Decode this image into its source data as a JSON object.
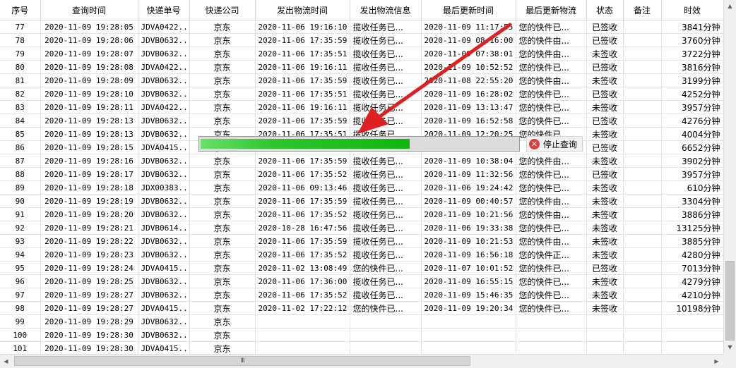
{
  "columns": [
    "序号",
    "查询时间",
    "快递单号",
    "快递公司",
    "发出物流时间",
    "发出物流信息",
    "最后更新时间",
    "最后更新物流",
    "状态",
    "备注",
    "时效"
  ],
  "rows": [
    [
      "77",
      "2020-11-09 19:28:05",
      "JDVA0422...",
      "京东",
      "2020-11-06 19:16:10",
      "揽收任务已...",
      "2020-11-09 11:17:55",
      "您的快件已...",
      "已签收",
      "",
      "3841分钟"
    ],
    [
      "78",
      "2020-11-09 19:28:06",
      "JDVB0632...",
      "京东",
      "2020-11-06 17:35:59",
      "揽收任务已...",
      "2020-11-09 08:16:00",
      "您的快件由...",
      "已签收",
      "",
      "3760分钟"
    ],
    [
      "79",
      "2020-11-09 19:28:07",
      "JDVB0632...",
      "京东",
      "2020-11-06 17:35:51",
      "揽收任务已...",
      "2020-11-09 07:38:01",
      "您的快件由...",
      "未签收",
      "",
      "3722分钟"
    ],
    [
      "80",
      "2020-11-09 19:28:08",
      "JDVA0422...",
      "京东",
      "2020-11-06 19:16:11",
      "揽收任务已...",
      "2020-11-09 10:52:52",
      "您的快件已...",
      "已签收",
      "",
      "3816分钟"
    ],
    [
      "81",
      "2020-11-09 19:28:09",
      "JDVB0632...",
      "京东",
      "2020-11-06 17:35:59",
      "揽收任务已...",
      "2020-11-08 22:55:20",
      "您的快件由...",
      "未签收",
      "",
      "3199分钟"
    ],
    [
      "82",
      "2020-11-09 19:28:10",
      "JDVB0632...",
      "京东",
      "2020-11-06 17:35:51",
      "揽收任务已...",
      "2020-11-09 16:28:02",
      "您的快件已...",
      "已签收",
      "",
      "4252分钟"
    ],
    [
      "83",
      "2020-11-09 19:28:11",
      "JDVA0422...",
      "京东",
      "2020-11-06 19:16:11",
      "揽收任务已...",
      "2020-11-09 13:13:47",
      "您的快件已...",
      "未签收",
      "",
      "3957分钟"
    ],
    [
      "84",
      "2020-11-09 19:28:13",
      "JDVB0632...",
      "京东",
      "2020-11-06 17:35:59",
      "揽收任务已...",
      "2020-11-09 16:52:58",
      "您的快件已...",
      "已签收",
      "",
      "4276分钟"
    ],
    [
      "85",
      "2020-11-09 19:28:13",
      "JDVB0632...",
      "京东",
      "2020-11-06 17:35:51",
      "揽收任务已...",
      "2020-11-09 12:20:25",
      "您的快件已...",
      "未签收",
      "",
      "4004分钟"
    ],
    [
      "86",
      "2020-11-09 19:28:15",
      "JDVA0415...",
      "京东",
      "",
      "",
      "",
      "",
      "已签收",
      "",
      "6652分钟"
    ],
    [
      "87",
      "2020-11-09 19:28:16",
      "JDVB0632...",
      "京东",
      "2020-11-06 17:35:59",
      "揽收任务已...",
      "2020-11-09 10:38:04",
      "您的快件由...",
      "未签收",
      "",
      "3902分钟"
    ],
    [
      "88",
      "2020-11-09 19:28:17",
      "JDVB0632...",
      "京东",
      "2020-11-06 17:35:52",
      "揽收任务已...",
      "2020-11-09 11:32:56",
      "您的快件已...",
      "已签收",
      "",
      "3957分钟"
    ],
    [
      "89",
      "2020-11-09 19:28:18",
      "JDX00383...",
      "京东",
      "2020-11-06 09:13:46",
      "揽收任务已...",
      "2020-11-06 19:24:42",
      "您的快件已...",
      "未签收",
      "",
      "610分钟"
    ],
    [
      "90",
      "2020-11-09 19:28:19",
      "JDVB0632...",
      "京东",
      "2020-11-06 17:35:59",
      "揽收任务已...",
      "2020-11-09 00:40:57",
      "您的快件由...",
      "未签收",
      "",
      "3304分钟"
    ],
    [
      "91",
      "2020-11-09 19:28:20",
      "JDVB0632...",
      "京东",
      "2020-11-06 17:35:52",
      "揽收任务已...",
      "2020-11-09 10:21:56",
      "您的快件由...",
      "未签收",
      "",
      "3886分钟"
    ],
    [
      "92",
      "2020-11-09 19:28:21",
      "JDVB0614...",
      "京东",
      "2020-10-28 16:47:56",
      "揽收任务已...",
      "2020-11-06 19:33:38",
      "您的快件已...",
      "未签收",
      "",
      "13125分钟"
    ],
    [
      "93",
      "2020-11-09 19:28:22",
      "JDVB0632...",
      "京东",
      "2020-11-06 17:35:59",
      "揽收任务已...",
      "2020-11-09 10:21:53",
      "您的快件由...",
      "未签收",
      "",
      "3885分钟"
    ],
    [
      "94",
      "2020-11-09 19:28:23",
      "JDVB0632...",
      "京东",
      "2020-11-06 17:35:52",
      "揽收任务已...",
      "2020-11-09 16:56:18",
      "您的快件正...",
      "未签收",
      "",
      "4280分钟"
    ],
    [
      "95",
      "2020-11-09 19:28:24",
      "JDVA0415...",
      "京东",
      "2020-11-02 13:08:49",
      "您的快件已...",
      "2020-11-07 10:01:52",
      "您的快件已...",
      "已签收",
      "",
      "7013分钟"
    ],
    [
      "96",
      "2020-11-09 19:28:25",
      "JDVB0632...",
      "京东",
      "2020-11-06 17:36:00",
      "揽收任务已...",
      "2020-11-09 16:55:15",
      "您的快件已...",
      "未签收",
      "",
      "4279分钟"
    ],
    [
      "97",
      "2020-11-09 19:28:27",
      "JDVB0632...",
      "京东",
      "2020-11-06 17:35:52",
      "揽收任务已...",
      "2020-11-09 15:46:35",
      "您的快件已...",
      "未签收",
      "",
      "4210分钟"
    ],
    [
      "98",
      "2020-11-09 19:28:27",
      "JDVA0415...",
      "京东",
      "2020-11-02 17:22:12",
      "您的快件已...",
      "2020-11-09 19:20:34",
      "您的快件已...",
      "未签收",
      "",
      "10198分钟"
    ],
    [
      "99",
      "2020-11-09 19:28:29",
      "JDVB0632...",
      "京东",
      "",
      "",
      "",
      "",
      "",
      "",
      ""
    ],
    [
      "100",
      "2020-11-09 19:28:30",
      "JDVB0632...",
      "京东",
      "",
      "",
      "",
      "",
      "",
      "",
      ""
    ],
    [
      "101",
      "2020-11-09 19:28:30",
      "JDVA0415...",
      "京东",
      "",
      "",
      "",
      "",
      "",
      "",
      ""
    ]
  ],
  "progress": {
    "value": 0.66
  },
  "stop_button": {
    "label": "停止查询",
    "icon": "stop-icon"
  },
  "scrollbar": {
    "h_thumb_label": "III"
  },
  "colors": {
    "progress_fill": "#11b511",
    "arrow": "#e02020",
    "stop_icon": "#e23b3b"
  }
}
